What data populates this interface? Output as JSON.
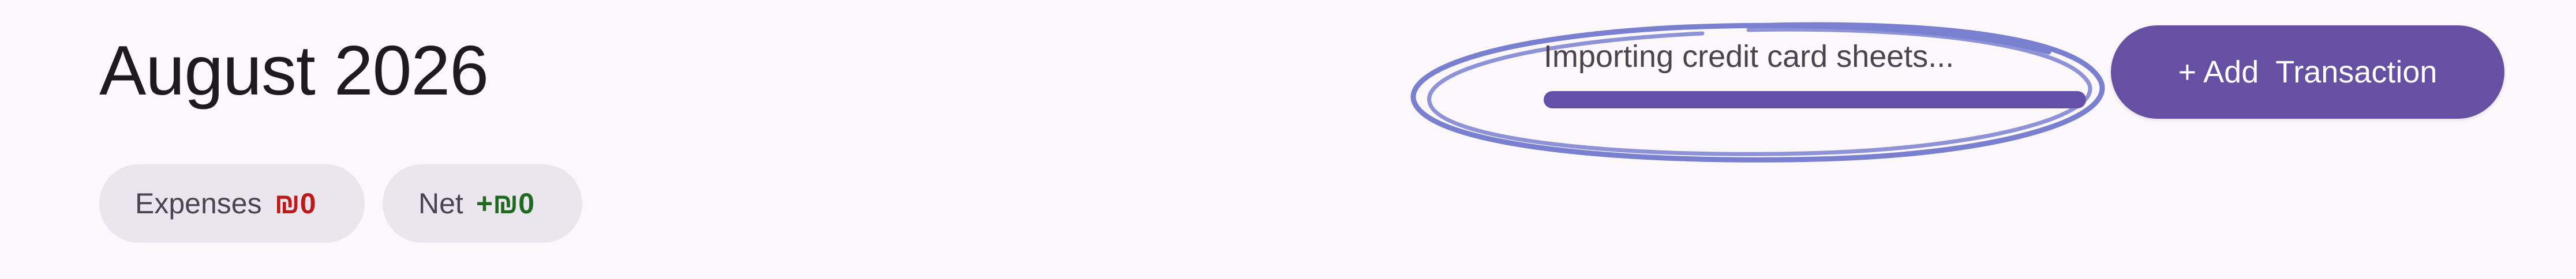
{
  "header": {
    "title": "August 2026"
  },
  "summary": {
    "expenses_label": "Expenses",
    "expenses_value": "₪0",
    "net_label": "Net",
    "net_value": "+₪0"
  },
  "import_status": {
    "text": "Importing credit card sheets...",
    "progress_fraction": 1.0
  },
  "toolbar": {
    "add_transaction_label": "+ Add  Transaction"
  },
  "colors": {
    "background": "#fcf7fb",
    "primary": "#6650a4",
    "annotation_circle": "#7a80d0",
    "negative": "#ba1a1a",
    "positive": "#1e6a1e"
  },
  "icons": {
    "annotation": "hand-drawn-circle-icon"
  }
}
